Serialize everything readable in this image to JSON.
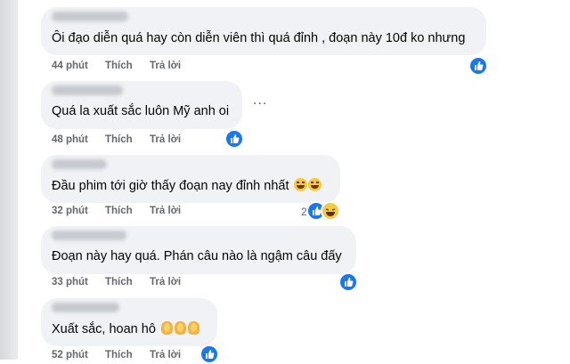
{
  "colors": {
    "accent": "#1877f2",
    "bubble": "#f0f2f5",
    "meta": "#65676b",
    "text": "#050505"
  },
  "comments": [
    {
      "text": "Ôi đạo diễn quá hay còn diễn viên thì quá đỉnh , đoạn này 10đ ko nhưng",
      "time": "44 phút",
      "like": "Thích",
      "reply": "Trả lời",
      "reactions": [
        "like-icon"
      ]
    },
    {
      "text": "Quá la xuất sắc luôn Mỹ anh oi",
      "time": "48 phút",
      "like": "Thích",
      "reply": "Trả lời",
      "reactions": [
        "like-icon"
      ],
      "more": "..."
    },
    {
      "text": "Đầu phim tới giờ thấy đoạn nay đỉnh nhất",
      "time": "32 phút",
      "like": "Thích",
      "reply": "Trả lời",
      "reactions": [
        "like-icon",
        "haha-icon"
      ],
      "reaction_count": "2",
      "emoji": [
        "laughing-emoji",
        "laughing-emoji"
      ]
    },
    {
      "text": "Đoạn này hay quá. Phán câu nào là ngậm câu đấy",
      "time": "33 phút",
      "like": "Thích",
      "reply": "Trả lời",
      "reactions": [
        "like-icon"
      ]
    },
    {
      "text": "Xuất sắc, hoan hô",
      "time": "52 phút",
      "like": "Thích",
      "reply": "Trả lời",
      "reactions": [
        "like-icon"
      ],
      "emoji": [
        "clapping-hands-emoji",
        "clapping-hands-emoji",
        "clapping-hands-emoji"
      ]
    }
  ]
}
